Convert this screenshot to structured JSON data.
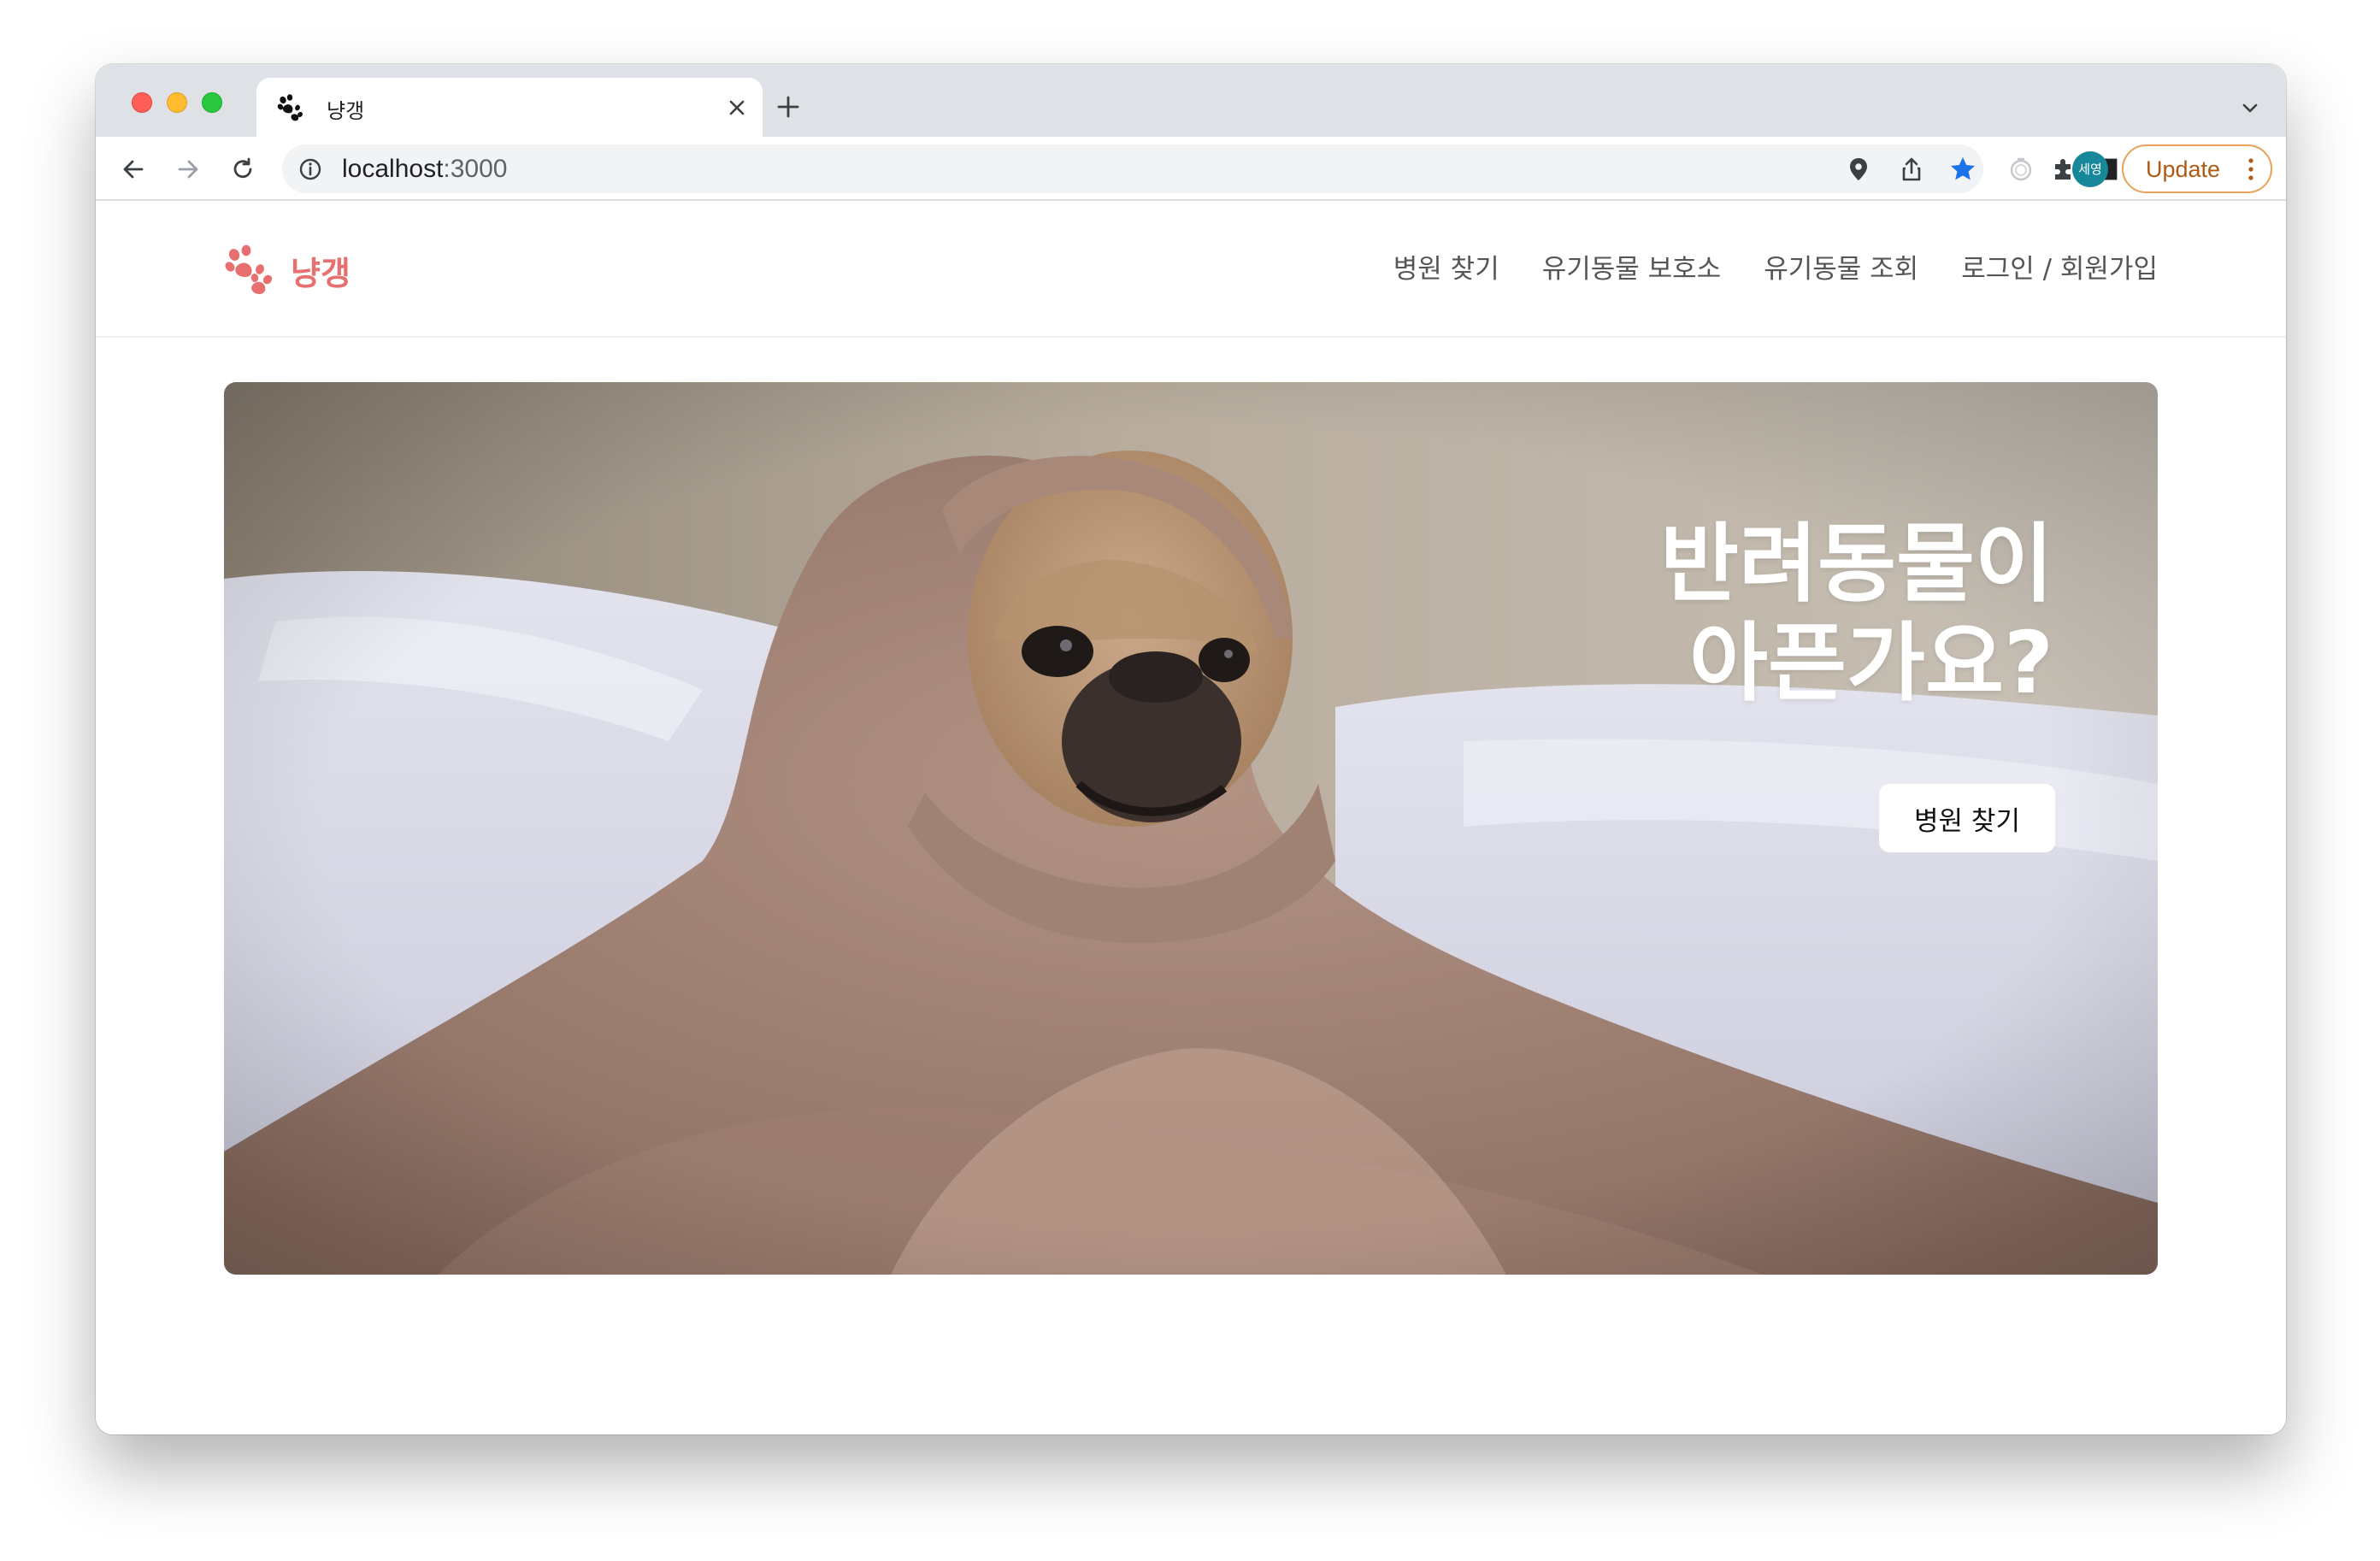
{
  "browser": {
    "tab_title": "냥갱",
    "url_host": "localhost",
    "url_port": ":3000",
    "update_label": "Update",
    "profile_label": "세영",
    "accent_color": "#1a73e8",
    "update_color": "#e8a15b"
  },
  "site": {
    "logo_text": "냥갱",
    "brand_color": "#e76f6f",
    "nav": [
      {
        "label": "병원 찾기"
      },
      {
        "label": "유기동물 보호소"
      },
      {
        "label": "유기동물 조회"
      },
      {
        "label": "로그인 / 회원가입"
      }
    ]
  },
  "hero": {
    "title_line1": "반려동물이",
    "title_line2": "아픈가요?",
    "button_label": "병원 찾기",
    "image_subject": "pug-wrapped-in-blanket"
  }
}
